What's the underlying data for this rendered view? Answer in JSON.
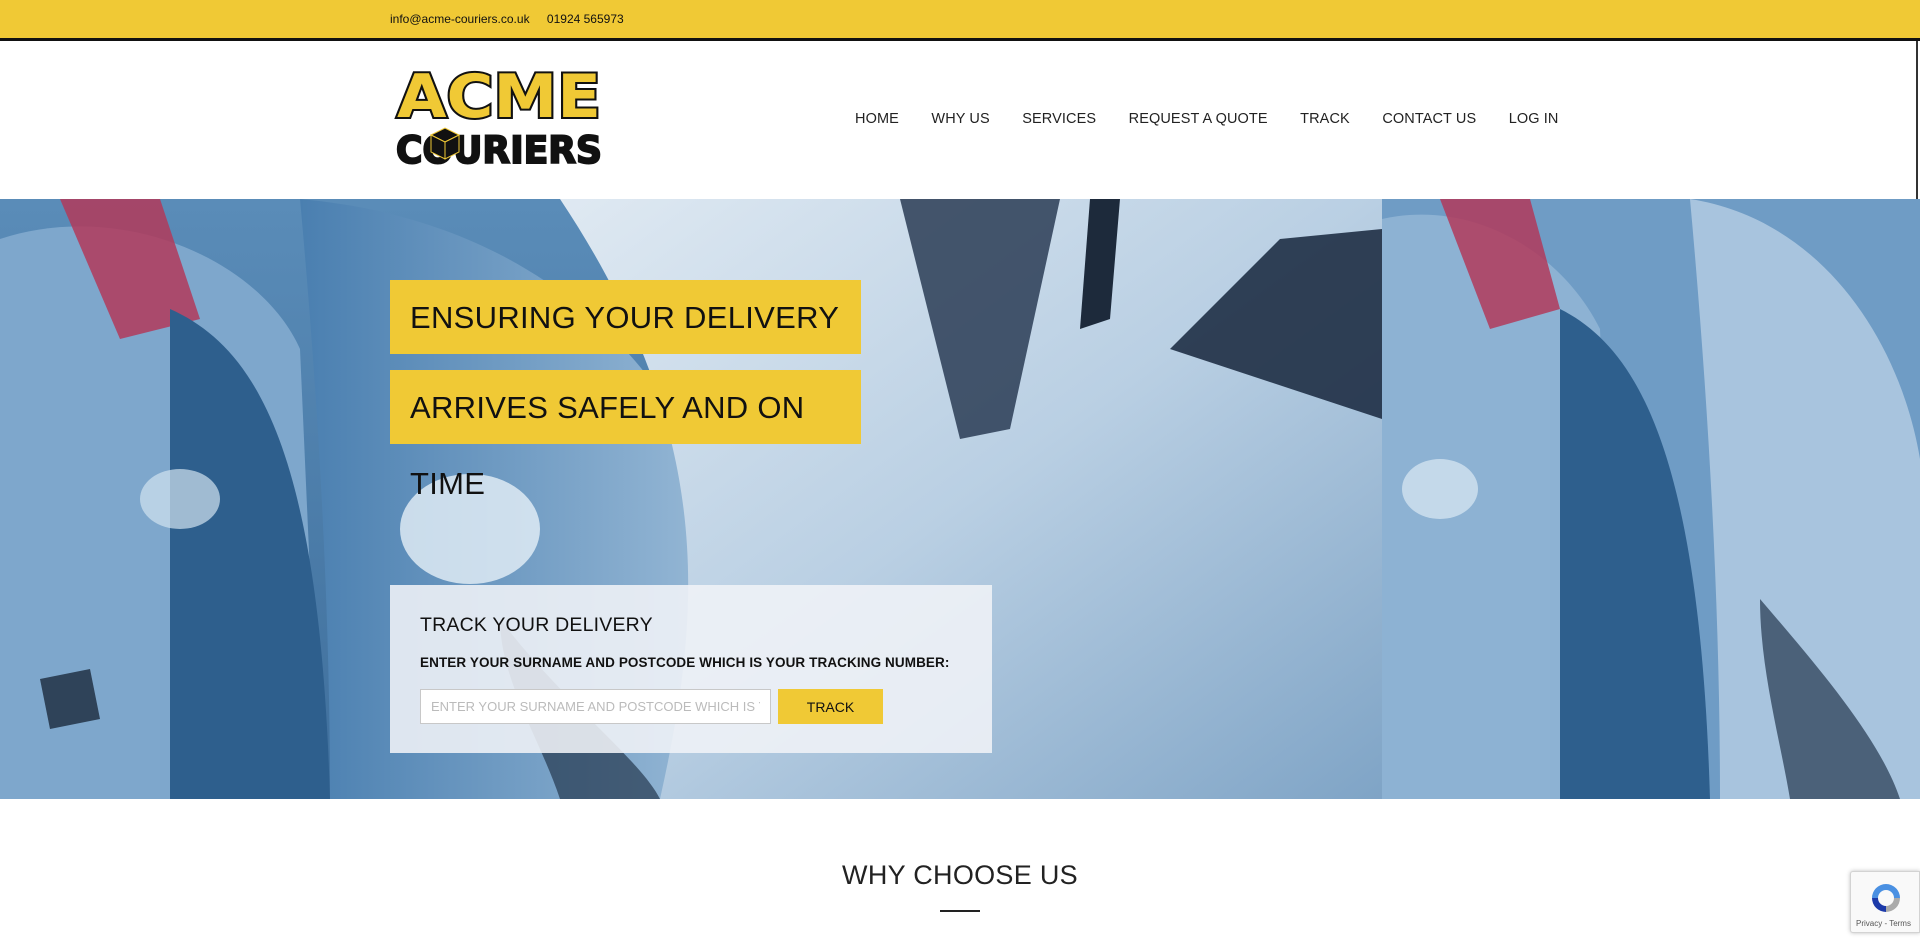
{
  "topbar": {
    "email": "info@acme-couriers.co.uk",
    "phone": "01924 565973"
  },
  "logo": {
    "line1": "ACME",
    "line2": "COURIERS"
  },
  "nav": {
    "items": [
      "HOME",
      "WHY US",
      "SERVICES",
      "REQUEST A QUOTE",
      "TRACK",
      "CONTACT US",
      "LOG IN"
    ]
  },
  "hero": {
    "slogan_line1": "ENSURING YOUR DELIVERY",
    "slogan_line2": "ARRIVES SAFELY AND ON TIME"
  },
  "track": {
    "heading": "TRACK YOUR DELIVERY",
    "instruction": "ENTER YOUR SURNAME AND POSTCODE WHICH IS YOUR TRACKING NUMBER:",
    "placeholder": "ENTER YOUR SURNAME AND POSTCODE WHICH IS Y",
    "button": "TRACK"
  },
  "why": {
    "heading": "WHY CHOOSE US"
  },
  "recaptcha": {
    "terms": "Privacy - Terms"
  },
  "colors": {
    "brand_yellow": "#f0c935",
    "dark": "#111111"
  }
}
